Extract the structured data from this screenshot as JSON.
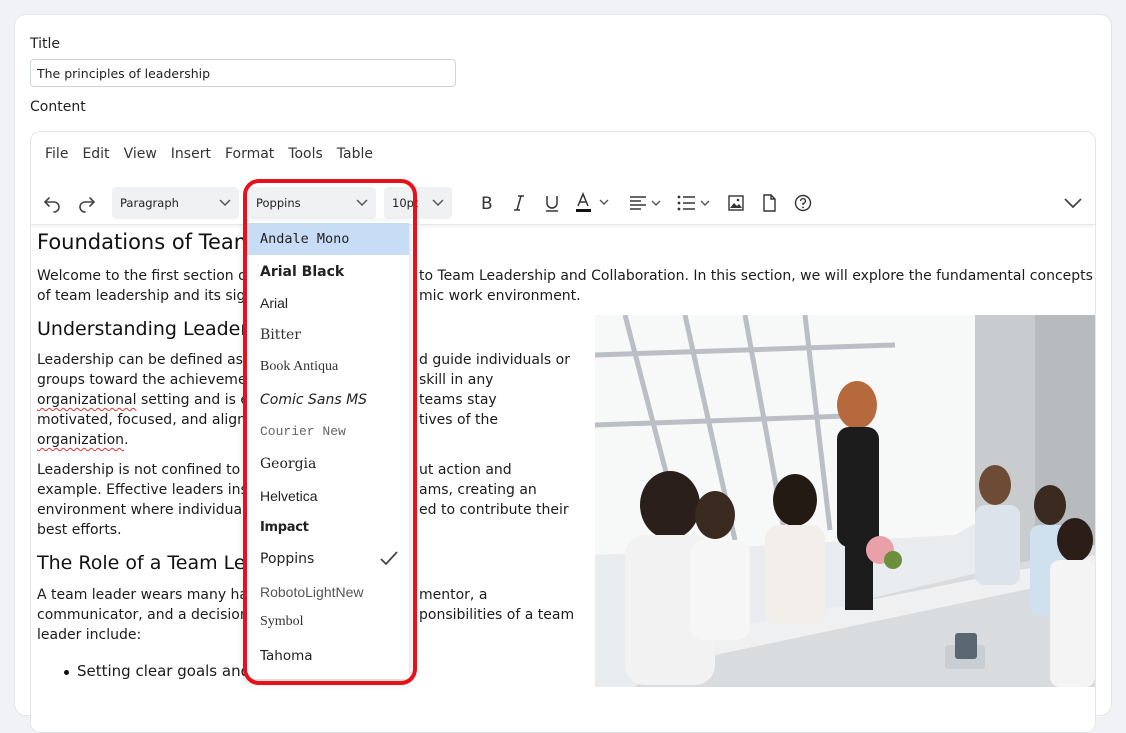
{
  "form": {
    "title_label": "Title",
    "title_value": "The principles of leadership",
    "content_label": "Content"
  },
  "menubar": [
    "File",
    "Edit",
    "View",
    "Insert",
    "Format",
    "Tools",
    "Table"
  ],
  "toolbar": {
    "block_format": "Paragraph",
    "font_family": "Poppins",
    "font_size": "10pt"
  },
  "document": {
    "h1": "Foundations of Team",
    "p1_line1": "Welcome to the first section of",
    "p1_line1b": "to Team Leadership and Collaboration. In this section, we will explore the fundamental concepts",
    "p1_line2": "of team leadership and its sign",
    "p1_line2b": "mic work environment.",
    "h2a": "Understanding Leader",
    "p2_l1a": "Leadership can be defined as",
    "p2_l1b": "d guide individuals or",
    "p2_l2a": "groups toward the achieveme",
    "p2_l2b": "skill in any",
    "p2_l3a": "organizational",
    "p2_l3b": " setting and is e",
    "p2_l3c": "teams stay",
    "p2_l4a": "motivated, focused, and aligne",
    "p2_l4b": "tives of the",
    "p2_l5": "organization",
    "p2_l5dot": ".",
    "p3_l1a": "Leadership is not confined to a",
    "p3_l1b": "ut action and",
    "p3_l2a": "example. Effective leaders insp",
    "p3_l2b": "ams, creating an",
    "p3_l3a": "environment where individuals",
    "p3_l3b": "ed to contribute their",
    "p3_l4": "best efforts.",
    "h2b": "The Role of a Team Le",
    "p4_l1a": "A team leader wears many ha",
    "p4_l1b": "mentor, a",
    "p4_l2a": "communicator, and a decision",
    "p4_l2b": "ponsibilities of a team",
    "p4_l3": "leader include:",
    "bullet1": "Setting clear goals and e"
  },
  "font_dropdown": {
    "selected": "Poppins",
    "items": [
      {
        "label": "Andale Mono",
        "active": true
      },
      {
        "label": "Arial Black"
      },
      {
        "label": "Arial"
      },
      {
        "label": "Bitter"
      },
      {
        "label": "Book Antiqua"
      },
      {
        "label": "Comic Sans MS"
      },
      {
        "label": "Courier New"
      },
      {
        "label": "Georgia"
      },
      {
        "label": "Helvetica"
      },
      {
        "label": "Impact"
      },
      {
        "label": "Poppins",
        "checked": true
      },
      {
        "label": "RobotoLightNew"
      },
      {
        "label": "Symbol"
      },
      {
        "label": "Tahoma"
      }
    ]
  },
  "colors": {
    "highlight": "#e8101b",
    "active_item": "#c7dcf5",
    "spellcheck": "#d33333"
  }
}
